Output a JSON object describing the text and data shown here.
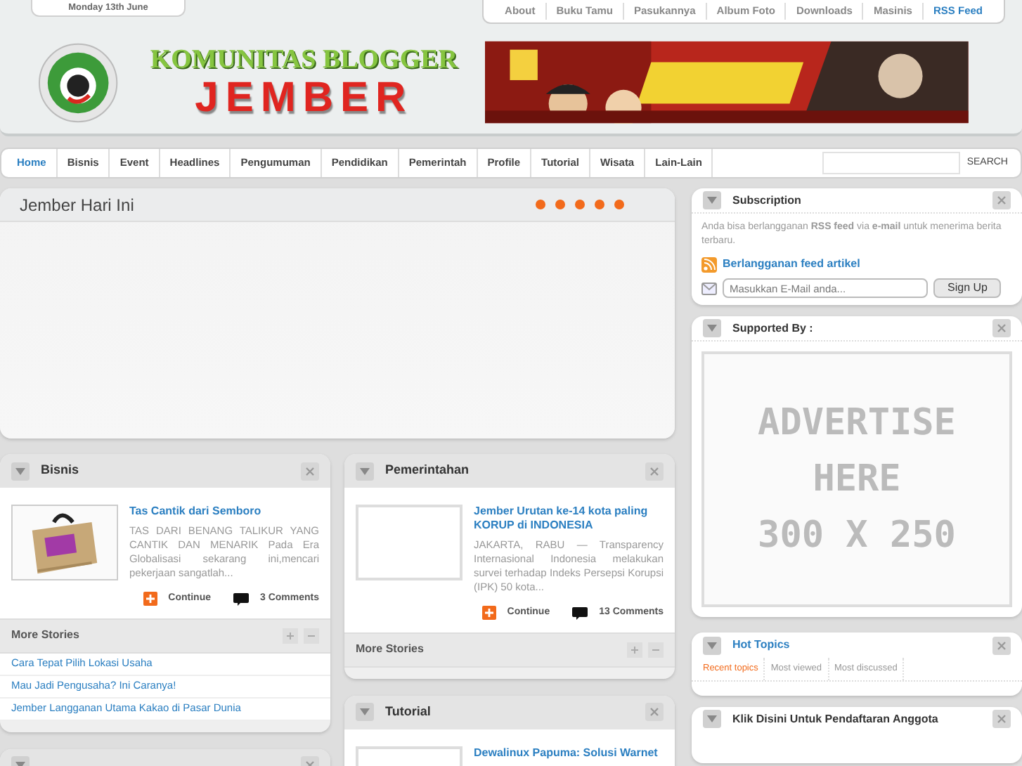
{
  "date": "Monday 13th June",
  "top_links": [
    {
      "label": "About",
      "kind": "link"
    },
    {
      "label": "Buku Tamu",
      "kind": "link"
    },
    {
      "label": "Pasukannya",
      "kind": "link"
    },
    {
      "label": "Album Foto",
      "kind": "link"
    },
    {
      "label": "Downloads",
      "kind": "link"
    },
    {
      "label": "Masinis",
      "kind": "link"
    },
    {
      "label": "RSS Feed",
      "kind": "feed"
    }
  ],
  "logo": {
    "line_1": "KOMUNITAS BLOGGER",
    "line_2": "JEMBER"
  },
  "nav": [
    {
      "label": "Home",
      "selected": true
    },
    {
      "label": "Bisnis",
      "selected": false
    },
    {
      "label": "Event",
      "selected": false
    },
    {
      "label": "Headlines",
      "selected": false
    },
    {
      "label": "Pengumuman",
      "selected": false
    },
    {
      "label": "Pendidikan",
      "selected": false
    },
    {
      "label": "Pemerintah",
      "selected": false
    },
    {
      "label": "Profile",
      "selected": false
    },
    {
      "label": "Tutorial",
      "selected": false
    },
    {
      "label": "Wisata",
      "selected": false
    },
    {
      "label": "Lain-Lain",
      "selected": false
    }
  ],
  "search": {
    "button": "SEARCH"
  },
  "featured": {
    "title": "Jember Hari Ini"
  },
  "left_column": [
    {
      "title": "Bisnis",
      "post": {
        "title": "Tas Cantik dari Semboro",
        "excerpt": "TAS DARI BENANG TALIKUR YANG CANTIK DAN MENARIK Pada Era Globalisasi sekarang ini,mencari pekerjaan sangatlah...",
        "continue": "Continue",
        "comments": "3 Comments"
      },
      "more": {
        "title": "More Stories",
        "links": [
          "Cara Tepat Pilih Lokasi Usaha",
          "Mau Jadi Pengusaha? Ini Caranya!",
          "Jember Langganan Utama Kakao di Pasar Dunia"
        ]
      }
    }
  ],
  "middle_column": [
    {
      "title": "Pemerintahan",
      "post": {
        "title": "Jember Urutan ke-14 kota paling KORUP di INDONESIA",
        "excerpt": "JAKARTA, RABU — Transparency Internasional Indonesia melakukan survei terhadap Indeks Persepsi Korupsi (IPK) 50 kota...",
        "image": {
          "kind": "frame"
        },
        "continue": "Continue",
        "comments": "13 Comments"
      },
      "more": {
        "title": "More Stories"
      }
    },
    {
      "title": "Tutorial",
      "post": {
        "title": "Dewalinux Papuma: Solusi Warnet",
        "image": {
          "kind": "frame"
        }
      }
    }
  ],
  "subscription": {
    "title": "Subscription",
    "text": "Anda bisa berlangganan **RSS feed** via **e-mail** untuk menerima berita terbaru.",
    "feed_link": "Berlangganan feed artikel",
    "email_placeholder": "Masukkan E-Mail anda...",
    "button": "Sign Up"
  },
  "supported": {
    "title": "Supported By :",
    "ad_lines": [
      "ADVERTISE",
      "HERE",
      "300 X 250"
    ]
  },
  "hot_topics": {
    "title": "Hot Topics",
    "tabs": [
      {
        "label": "Recent topics",
        "selected": true
      },
      {
        "label": "Most viewed",
        "selected": false
      },
      {
        "label": "Most discussed",
        "selected": false
      }
    ]
  },
  "register": {
    "title": "Klik Disini Untuk Pendaftaran Anggota"
  }
}
